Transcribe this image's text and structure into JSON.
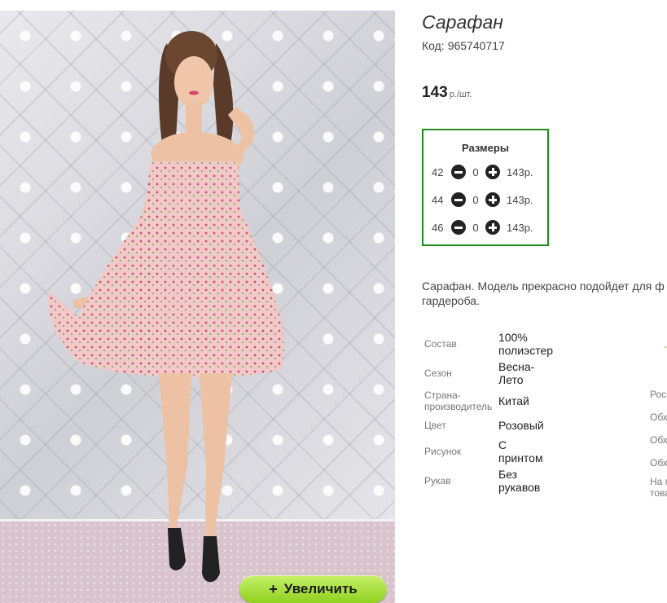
{
  "product": {
    "title": "Сарафан",
    "code_label": "Код:",
    "code_value": "965740717",
    "price": "143",
    "price_unit": "р./шт.",
    "description_line1": "Сарафан. Модель прекрасно подойдет для ф",
    "description_line2": "гардероба."
  },
  "zoom": {
    "plus": "+",
    "label": "Увеличить"
  },
  "sizes": {
    "title": "Размеры",
    "rows": [
      {
        "size": "42",
        "qty": "0",
        "price": "143р."
      },
      {
        "size": "44",
        "qty": "0",
        "price": "143р."
      },
      {
        "size": "46",
        "qty": "0",
        "price": "143р."
      }
    ]
  },
  "specs": [
    {
      "label": "Состав",
      "value": "100% полиэстер"
    },
    {
      "label": "Сезон",
      "value": "Весна-Лето"
    },
    {
      "label": "Страна-производитель",
      "value": "Китай"
    },
    {
      "label": "Цвет",
      "value": "Розовый"
    },
    {
      "label": "Рисунок",
      "value": "С принтом"
    },
    {
      "label": "Рукав",
      "value": "Без рукавов"
    }
  ],
  "specs_right": [
    "Рос",
    "Обх",
    "Обх",
    "Обх",
    "На г",
    "това"
  ],
  "specs_right_mark": "-",
  "colors": {
    "sizes_border": "#1e8c1e",
    "zoom_button": "#a6e03a"
  }
}
